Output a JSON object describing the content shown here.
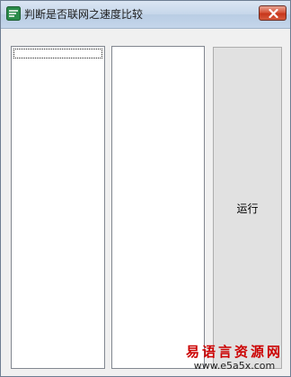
{
  "window": {
    "title": "判断是否联网之速度比较",
    "icon": "app-icon",
    "close_icon": "close-icon"
  },
  "controls": {
    "list_left": {
      "items": [
        ""
      ]
    },
    "list_right": {
      "items": []
    },
    "run_button_label": "运行"
  },
  "watermark": {
    "brand": "易语言资源网",
    "url": "www.e5a5x.com"
  },
  "colors": {
    "close_button": "#c7361b",
    "watermark_brand": "#cc0000",
    "button_face": "#e1e1e1"
  }
}
